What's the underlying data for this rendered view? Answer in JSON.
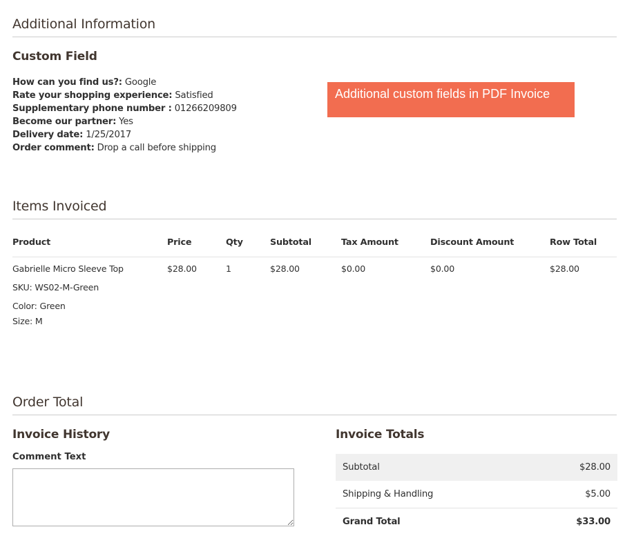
{
  "additional_information": {
    "title": "Additional Information",
    "custom_field": {
      "title": "Custom Field",
      "fields": [
        {
          "label": "How can you find us?:",
          "value": "Google"
        },
        {
          "label": "Rate your shopping experience:",
          "value": "Satisfied"
        },
        {
          "label": "Supplementary phone number :",
          "value": "01266209809"
        },
        {
          "label": "Become our partner:",
          "value": "Yes"
        },
        {
          "label": "Delivery date:",
          "value": "1/25/2017"
        },
        {
          "label": "Order comment:",
          "value": "Drop a call before shipping"
        }
      ]
    },
    "banner": {
      "text": "Additional custom fields in PDF Invoice",
      "color": "#f26d50"
    }
  },
  "items_invoiced": {
    "title": "Items Invoiced",
    "columns": [
      "Product",
      "Price",
      "Qty",
      "Subtotal",
      "Tax Amount",
      "Discount Amount",
      "Row Total"
    ],
    "rows": [
      {
        "product": "Gabrielle Micro Sleeve Top",
        "sku": "SKU: WS02-M-Green",
        "options": [
          {
            "label": "Color:",
            "value": "Green"
          },
          {
            "label": "Size:",
            "value": "M"
          }
        ],
        "price": "$28.00",
        "qty": "1",
        "subtotal": "$28.00",
        "tax_amount": "$0.00",
        "discount_amount": "$0.00",
        "row_total": "$28.00"
      }
    ]
  },
  "order_total": {
    "title": "Order Total",
    "invoice_history": {
      "title": "Invoice History",
      "comment_label": "Comment Text",
      "comment_value": ""
    },
    "invoice_totals": {
      "title": "Invoice Totals",
      "rows": [
        {
          "label": "Subtotal",
          "value": "$28.00"
        },
        {
          "label": "Shipping & Handling",
          "value": "$5.00"
        },
        {
          "label": "Grand Total",
          "value": "$33.00"
        }
      ]
    }
  }
}
